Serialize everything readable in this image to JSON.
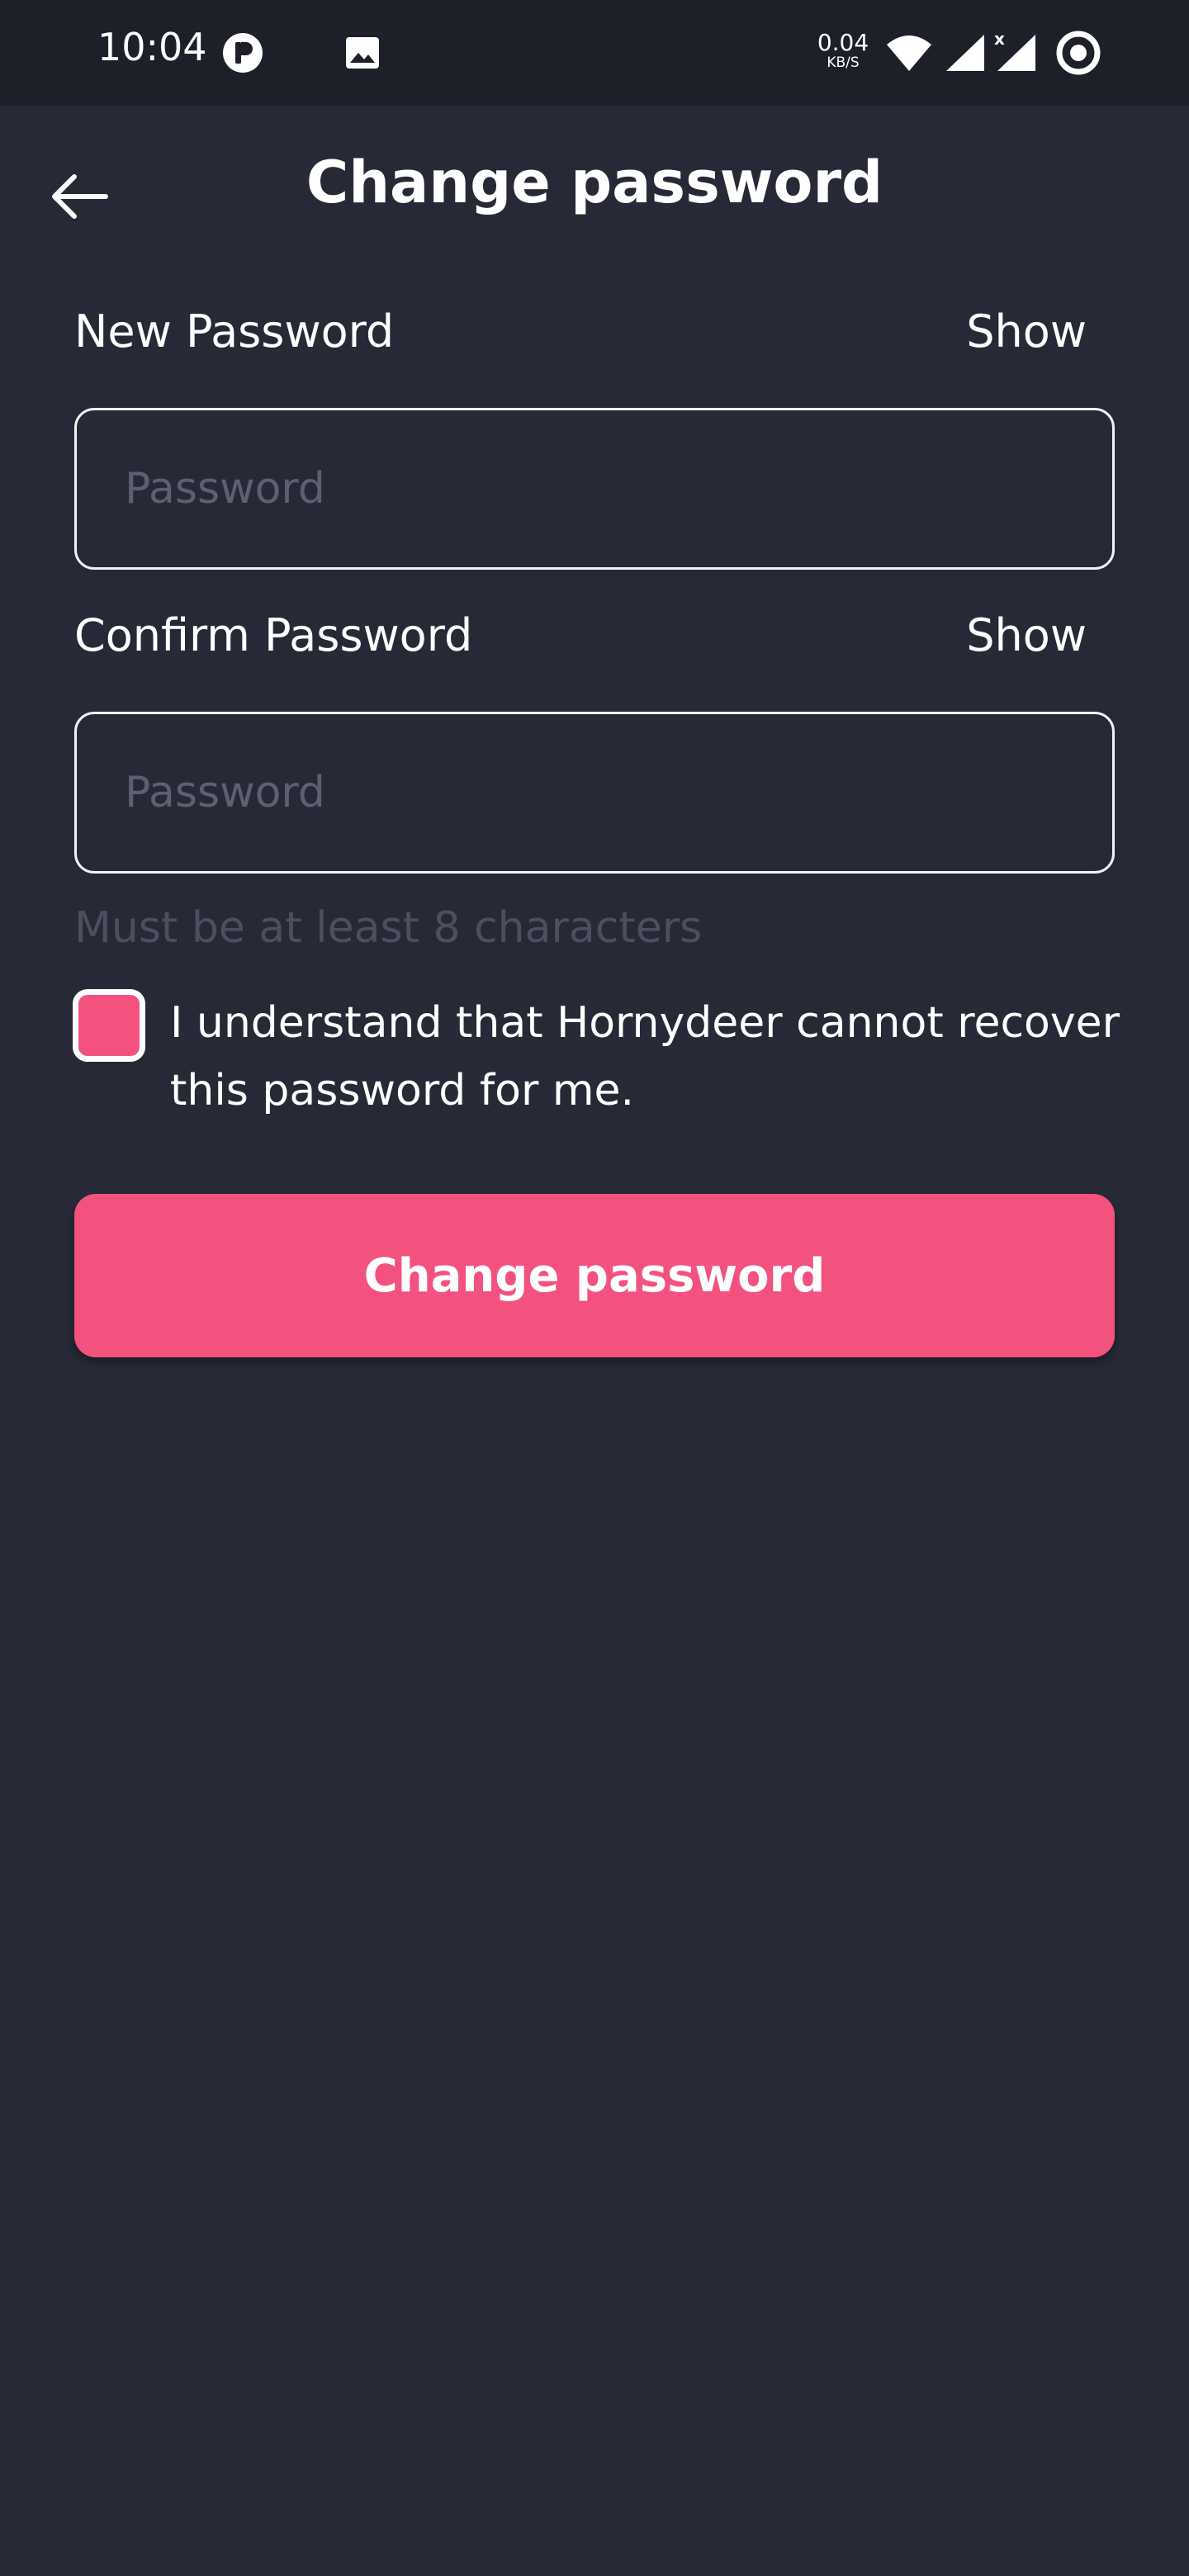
{
  "status_bar": {
    "time": "10:04",
    "net_speed_value": "0.04",
    "net_speed_unit": "KB/S",
    "icons": [
      "app-notification-icon",
      "image-icon",
      "wifi-icon",
      "signal-icon",
      "signal-no-service-icon",
      "target-icon"
    ]
  },
  "header": {
    "title": "Change password",
    "back_icon": "arrow-left-icon"
  },
  "form": {
    "new_password": {
      "label": "New Password",
      "toggle": "Show",
      "placeholder": "Password",
      "value": ""
    },
    "confirm_password": {
      "label": "Confirm Password",
      "toggle": "Show",
      "placeholder": "Password",
      "value": ""
    },
    "hint": "Must be at least 8 characters",
    "acknowledge": {
      "text": "I understand that Hornydeer cannot recover this password for me.",
      "checked": false
    },
    "submit_label": "Change password"
  },
  "colors": {
    "background": "#272a36",
    "status_bar": "#1e2029",
    "accent": "#f3527f",
    "hint": "#4b4f5e"
  }
}
